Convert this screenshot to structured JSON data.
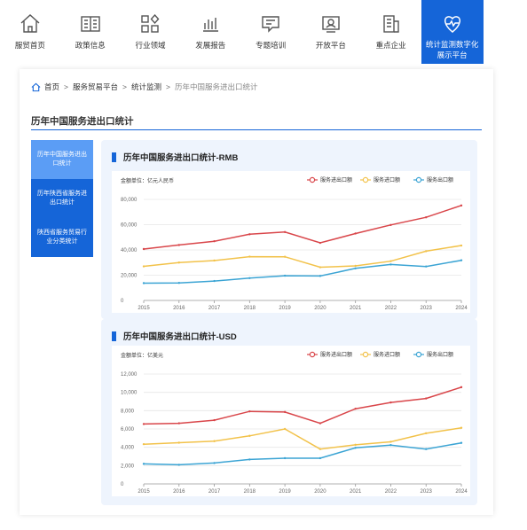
{
  "nav": {
    "items": [
      {
        "label": "服贸首页",
        "icon": "home-icon"
      },
      {
        "label": "政策信息",
        "icon": "policy-icon"
      },
      {
        "label": "行业领域",
        "icon": "industry-icon"
      },
      {
        "label": "发展报告",
        "icon": "report-icon"
      },
      {
        "label": "专题培训",
        "icon": "training-icon"
      },
      {
        "label": "开放平台",
        "icon": "platform-icon"
      },
      {
        "label": "重点企业",
        "icon": "enterprise-icon"
      },
      {
        "label": "统计监测数字化展示平台",
        "icon": "monitor-icon"
      }
    ],
    "active_index": 7,
    "accent": "#1565d8"
  },
  "breadcrumb": {
    "items": [
      "首页",
      "服务贸易平台",
      "统计监测"
    ],
    "current": "历年中国服务进出口统计",
    "separator": ">"
  },
  "page": {
    "title": "历年中国服务进出口统计"
  },
  "sidemenu": {
    "items": [
      {
        "label": "历年中国服务进出口统计",
        "active": true
      },
      {
        "label": "历年陕西省服务进出口统计",
        "active": false
      },
      {
        "label": "陕西省服务贸易行业分类统计",
        "active": false
      }
    ]
  },
  "chart_data": [
    {
      "type": "line",
      "title": "历年中国服务进出口统计-RMB",
      "unit_label": "金额单位：亿元人民币",
      "x": [
        "2015",
        "2016",
        "2017",
        "2018",
        "2019",
        "2020",
        "2021",
        "2022",
        "2023",
        "2024"
      ],
      "ylim": [
        0,
        80000
      ],
      "yticks": [
        0,
        20000,
        40000,
        60000,
        80000
      ],
      "ytick_labels": [
        "0",
        "20,000",
        "40,000",
        "60,000",
        "80,000"
      ],
      "grid": true,
      "legend": "top-right",
      "series": [
        {
          "name": "服务进出口额",
          "color": "#d9464a",
          "values": [
            40700,
            43900,
            46900,
            52400,
            54200,
            45600,
            53000,
            59800,
            65800,
            75200
          ]
        },
        {
          "name": "服务进口额",
          "color": "#f2c24a",
          "values": [
            27000,
            30000,
            31600,
            34700,
            34600,
            26300,
            27400,
            31100,
            39000,
            43500
          ]
        },
        {
          "name": "服务出口额",
          "color": "#3ba4d4",
          "values": [
            13700,
            13900,
            15400,
            17700,
            19600,
            19400,
            25400,
            28500,
            26900,
            31800
          ]
        }
      ]
    },
    {
      "type": "line",
      "title": "历年中国服务进出口统计-USD",
      "unit_label": "金额单位：亿美元",
      "x": [
        "2015",
        "2016",
        "2017",
        "2018",
        "2019",
        "2020",
        "2021",
        "2022",
        "2023",
        "2024"
      ],
      "ylim": [
        0,
        12000
      ],
      "yticks": [
        0,
        2000,
        4000,
        6000,
        8000,
        10000,
        12000
      ],
      "ytick_labels": [
        "0",
        "2,000",
        "4,000",
        "6,000",
        "8,000",
        "10,000",
        "12,000"
      ],
      "grid": true,
      "legend": "top-right",
      "series": [
        {
          "name": "服务进出口额",
          "color": "#d9464a",
          "values": [
            6540,
            6620,
            6960,
            7920,
            7850,
            6620,
            8210,
            8890,
            9330,
            10560
          ]
        },
        {
          "name": "服务进口额",
          "color": "#f2c24a",
          "values": [
            4340,
            4500,
            4670,
            5250,
            6000,
            3800,
            4270,
            4600,
            5530,
            6120
          ]
        },
        {
          "name": "服务出口额",
          "color": "#3ba4d4",
          "values": [
            2190,
            2090,
            2280,
            2670,
            2810,
            2810,
            3940,
            4240,
            3800,
            4480
          ]
        }
      ]
    }
  ]
}
